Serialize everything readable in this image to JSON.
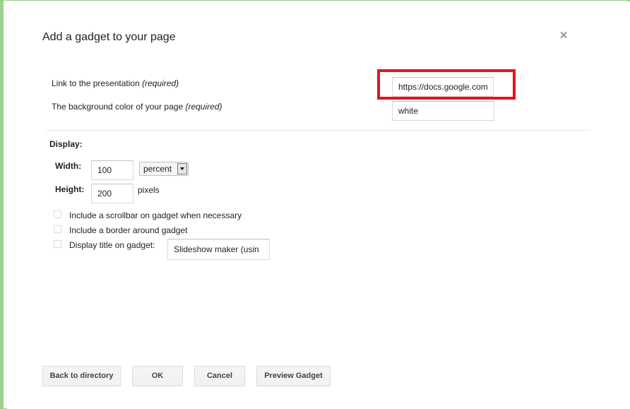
{
  "dialog": {
    "title": "Add a gadget to your page",
    "close_icon": "close-icon"
  },
  "fields": {
    "presentation_link": {
      "label": "Link to the presentation",
      "required": "(required)",
      "value": "https://docs.google.com"
    },
    "background_color": {
      "label": "The background color of your page",
      "required": "(required)",
      "value": "white"
    }
  },
  "display": {
    "section_label": "Display:",
    "width": {
      "label": "Width:",
      "value": "100",
      "unit": "percent"
    },
    "height": {
      "label": "Height:",
      "value": "200",
      "unit": "pixels"
    },
    "options": [
      {
        "label": "Include a scrollbar on gadget when necessary",
        "checked": false
      },
      {
        "label": "Include a border around gadget",
        "checked": false
      },
      {
        "label": "Display title on gadget:",
        "checked": false
      }
    ],
    "title_value": "Slideshow maker (usin"
  },
  "buttons": {
    "back": "Back to directory",
    "ok": "OK",
    "cancel": "Cancel",
    "preview": "Preview Gadget"
  },
  "colors": {
    "highlight": "#e5141e",
    "frame": "#9cd08f"
  }
}
